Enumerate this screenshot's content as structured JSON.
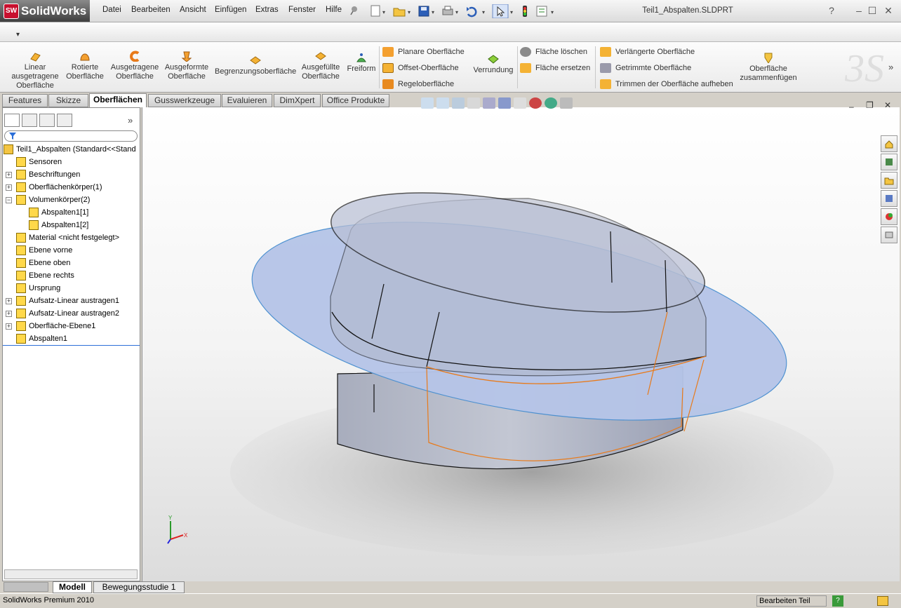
{
  "app": {
    "logo_text": "SolidWorks",
    "logo_badge": "SW",
    "doc_title": "Teil1_Abspalten.SLDPRT"
  },
  "menu": [
    "Datei",
    "Bearbeiten",
    "Ansicht",
    "Einfügen",
    "Extras",
    "Fenster",
    "Hilfe"
  ],
  "window": {
    "help": "?",
    "minimize": "–",
    "maximize": "☐",
    "close": "✕"
  },
  "dropstrip": {
    "arrow": "▾"
  },
  "ribbon": {
    "big": [
      {
        "label": "Linear ausgetragene Oberfläche"
      },
      {
        "label": "Rotierte Oberfläche"
      },
      {
        "label": "Ausgetragene Oberfläche"
      },
      {
        "label": "Ausgeformte Oberfläche"
      },
      {
        "label": "Begrenzungsoberfläche"
      },
      {
        "label": "Ausgefüllte Oberfläche"
      },
      {
        "label": "Freiform"
      }
    ],
    "small1": [
      "Planare Oberfläche",
      "Offset-Oberfläche",
      "Regeloberfläche"
    ],
    "verrundung": "Verrundung",
    "small2": [
      "Fläche löschen",
      "Fläche ersetzen"
    ],
    "small3": [
      "Verlängerte Oberfläche",
      "Getrimmte Oberfläche",
      "Trimmen der Oberfläche aufheben"
    ],
    "zusammen": "Oberfläche zusammenfügen",
    "more": "»"
  },
  "tabs": [
    "Features",
    "Skizze",
    "Oberflächen",
    "Gusswerkzeuge",
    "Evaluieren",
    "DimXpert",
    "Office Produkte"
  ],
  "tree": {
    "root": "Teil1_Abspalten  (Standard<<Stand",
    "items": [
      {
        "label": "Sensoren",
        "level": 1,
        "exp": ""
      },
      {
        "label": "Beschriftungen",
        "level": 1,
        "exp": "+"
      },
      {
        "label": "Oberflächenkörper(1)",
        "level": 1,
        "exp": "+"
      },
      {
        "label": "Volumenkörper(2)",
        "level": 1,
        "exp": "−"
      },
      {
        "label": "Abspalten1[1]",
        "level": 2,
        "exp": ""
      },
      {
        "label": "Abspalten1[2]",
        "level": 2,
        "exp": ""
      },
      {
        "label": "Material <nicht festgelegt>",
        "level": 1,
        "exp": ""
      },
      {
        "label": "Ebene vorne",
        "level": 1,
        "exp": ""
      },
      {
        "label": "Ebene oben",
        "level": 1,
        "exp": ""
      },
      {
        "label": "Ebene rechts",
        "level": 1,
        "exp": ""
      },
      {
        "label": "Ursprung",
        "level": 1,
        "exp": ""
      },
      {
        "label": "Aufsatz-Linear austragen1",
        "level": 1,
        "exp": "+"
      },
      {
        "label": "Aufsatz-Linear austragen2",
        "level": 1,
        "exp": "+"
      },
      {
        "label": "Oberfläche-Ebene1",
        "level": 1,
        "exp": "+"
      },
      {
        "label": "Abspalten1",
        "level": 1,
        "exp": ""
      }
    ]
  },
  "pane": {
    "more": "»"
  },
  "triad": {
    "x": "X",
    "y": "Y"
  },
  "bottom_tabs": [
    "Modell",
    "Bewegungsstudie 1"
  ],
  "status": {
    "left": "SolidWorks Premium 2010",
    "mode": "Bearbeiten Teil",
    "help": "?"
  },
  "viewport": {
    "min": "–",
    "restore": "❐",
    "close": "✕"
  },
  "colors": {
    "surface": "#b3c4e8",
    "body": "#9aa2b8",
    "split_edge": "#e87a1a"
  }
}
